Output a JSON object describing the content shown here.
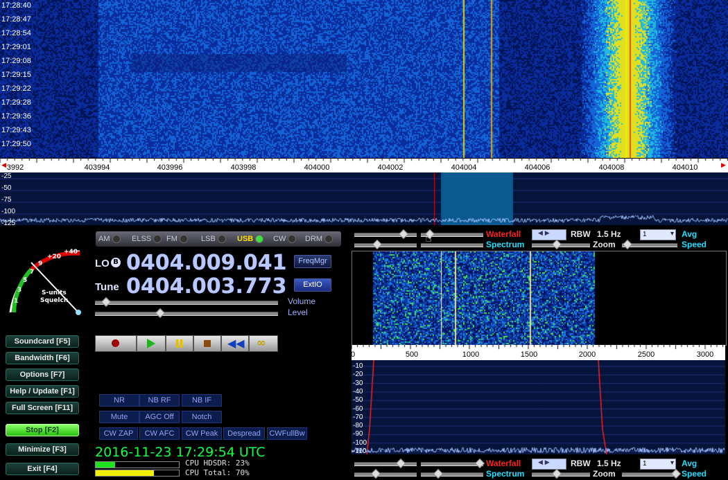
{
  "waterfall": {
    "time_labels": [
      "17:28:40",
      "17:28:47",
      "17:28:54",
      "17:29:01",
      "17:29:08",
      "17:29:15",
      "17:29:22",
      "17:29:28",
      "17:29:36",
      "17:29:43",
      "17:29:50"
    ],
    "freq_labels": [
      "3992",
      "403994",
      "403996",
      "403998",
      "404000",
      "404002",
      "404004",
      "404006",
      "404008",
      "404010"
    ],
    "db_labels": [
      "-25",
      "-50",
      "-75",
      "-100",
      "-125"
    ]
  },
  "modes": [
    {
      "label": "AM",
      "active": false
    },
    {
      "label": "ELSS",
      "active": false
    },
    {
      "label": "FM",
      "active": false
    },
    {
      "label": "LSB",
      "active": false
    },
    {
      "label": "USB",
      "active": true
    },
    {
      "label": "CW",
      "active": false
    },
    {
      "label": "DRM",
      "active": false
    }
  ],
  "lo": {
    "label": "LO",
    "badge": "B",
    "value": "0404.009.041"
  },
  "tune": {
    "label": "Tune",
    "value": "0404.003.773"
  },
  "buttons": {
    "freqmgr": "FreqMgr",
    "extio": "ExtIO",
    "volume": "Volume",
    "level": "Level"
  },
  "smeter": {
    "label1": "S-units",
    "label2": "Squelch",
    "scale": [
      "+40",
      "+20",
      "9",
      "7",
      "5",
      "3",
      "1"
    ]
  },
  "side_buttons": [
    {
      "label": "Soundcard  [F5]"
    },
    {
      "label": "Bandwidth  [F6]"
    },
    {
      "label": "Options  [F7]"
    },
    {
      "label": "Help / Update  [F1]"
    },
    {
      "label": "Full Screen  [F11]"
    },
    {
      "label": "Stop  [F2]"
    },
    {
      "label": "Minimize  [F3]"
    },
    {
      "label": "Exit  [F4]"
    }
  ],
  "dsp_buttons": [
    {
      "label": "NR"
    },
    {
      "label": "NB RF"
    },
    {
      "label": "NB IF"
    },
    {
      "label": "Mute"
    },
    {
      "label": "AGC Off"
    },
    {
      "label": "Notch"
    },
    {
      "label": "CW ZAP"
    },
    {
      "label": "CW AFC"
    },
    {
      "label": "CW Peak"
    },
    {
      "label": "Despread"
    },
    {
      "label": "CWFullBw"
    }
  ],
  "status": {
    "datetime": "2016-11-23   17:29:54 UTC",
    "cpu_hdsdr": "CPU HDSDR: 23%",
    "cpu_total": "CPU Total: 70%",
    "cpu_hdsdr_pct": 23,
    "cpu_total_pct": 70
  },
  "right_controls": {
    "waterfall": "Waterfall",
    "spectrum": "Spectrum",
    "rbw_label": "RBW",
    "rbw_value": "1.5 Hz",
    "zoom": "Zoom",
    "avg": "Avg",
    "speed": "Speed",
    "avg_value": "1"
  },
  "sub_ruler": [
    "0",
    "500",
    "1000",
    "1500",
    "2000",
    "2500",
    "3000"
  ],
  "sub_db": [
    "-10",
    "-20",
    "-30",
    "-40",
    "-50",
    "-60",
    "-70",
    "-80",
    "-90",
    "-100",
    "-110"
  ]
}
